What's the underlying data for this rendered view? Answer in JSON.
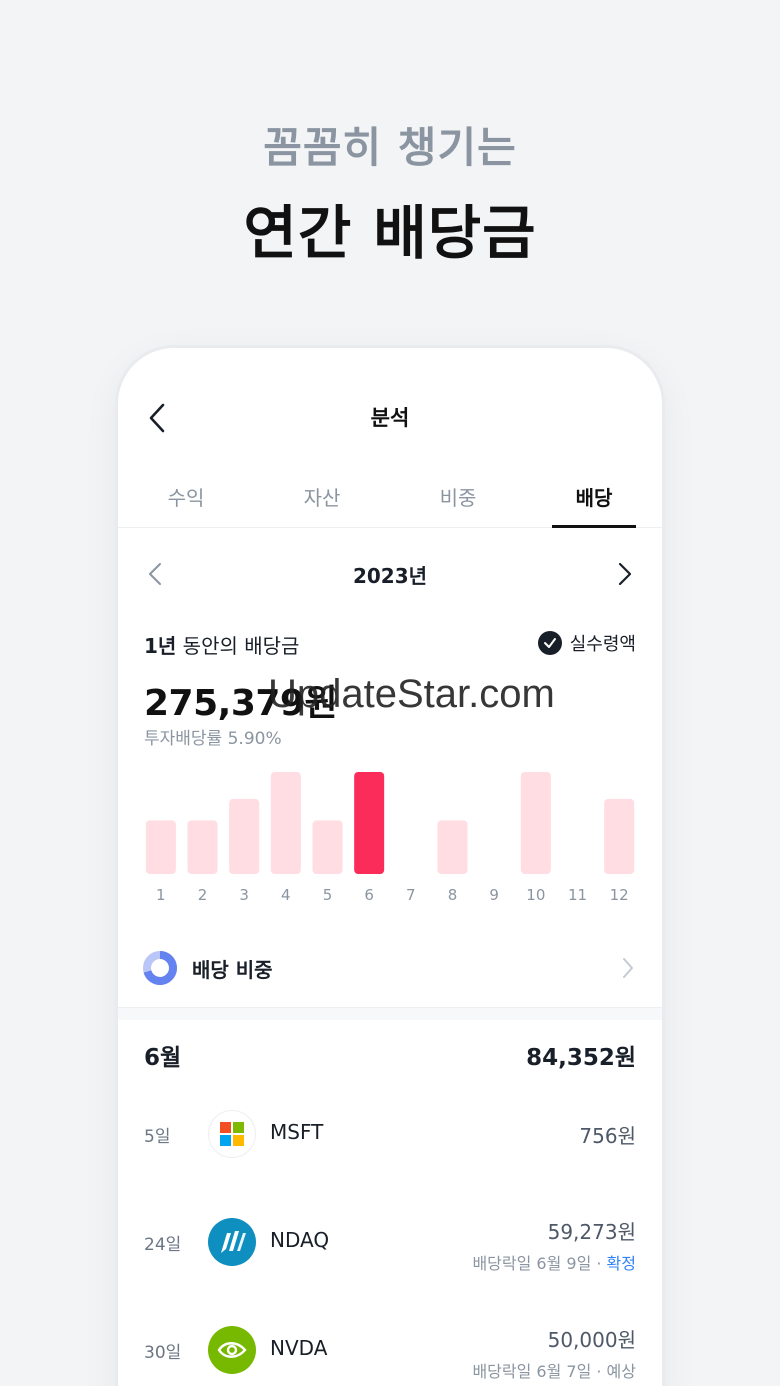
{
  "promo": {
    "subtitle": "꼼꼼히 챙기는",
    "title": "연간 배당금"
  },
  "header": {
    "title": "분석"
  },
  "tabs": [
    {
      "label": "수익",
      "active": false
    },
    {
      "label": "자산",
      "active": false
    },
    {
      "label": "비중",
      "active": false
    },
    {
      "label": "배당",
      "active": true
    }
  ],
  "year": {
    "label": "2023년"
  },
  "summary": {
    "label_bold": "1년",
    "label_rest": " 동안의 배당금",
    "toggle_label": "실수령액",
    "amount": "275,379원",
    "yield": "투자배당률 5.90%"
  },
  "watermark": "UpdateStar.com",
  "chart_data": {
    "type": "bar",
    "categories": [
      "1",
      "2",
      "3",
      "4",
      "5",
      "6",
      "7",
      "8",
      "9",
      "10",
      "11",
      "12"
    ],
    "values": [
      2,
      2,
      2.8,
      3.8,
      2,
      3.8,
      0,
      2,
      0,
      3.8,
      0,
      2.8
    ],
    "highlight_index": 5,
    "bar_color": "#ffdde3",
    "highlight_color": "#fc2c5a"
  },
  "ratio": {
    "label": "배당 비중"
  },
  "month": {
    "title": "6월",
    "total": "84,352원"
  },
  "dividends": [
    {
      "day": "5일",
      "ticker": "MSFT",
      "logo": "microsoft-logo",
      "amount": "756원",
      "meta": "",
      "status": ""
    },
    {
      "day": "24일",
      "ticker": "NDAQ",
      "logo": "nasdaq-logo",
      "amount": "59,273원",
      "meta": "배당락일 6월 9일 · ",
      "status": "확정"
    },
    {
      "day": "30일",
      "ticker": "NVDA",
      "logo": "nvidia-logo",
      "amount": "50,000원",
      "meta": "배당락일 6월 7일 · ",
      "status": "예상"
    }
  ],
  "colors": {
    "accent": "#fc2c5a",
    "bar_light": "#ffdde3",
    "confirmed_blue": "#3182f6"
  }
}
